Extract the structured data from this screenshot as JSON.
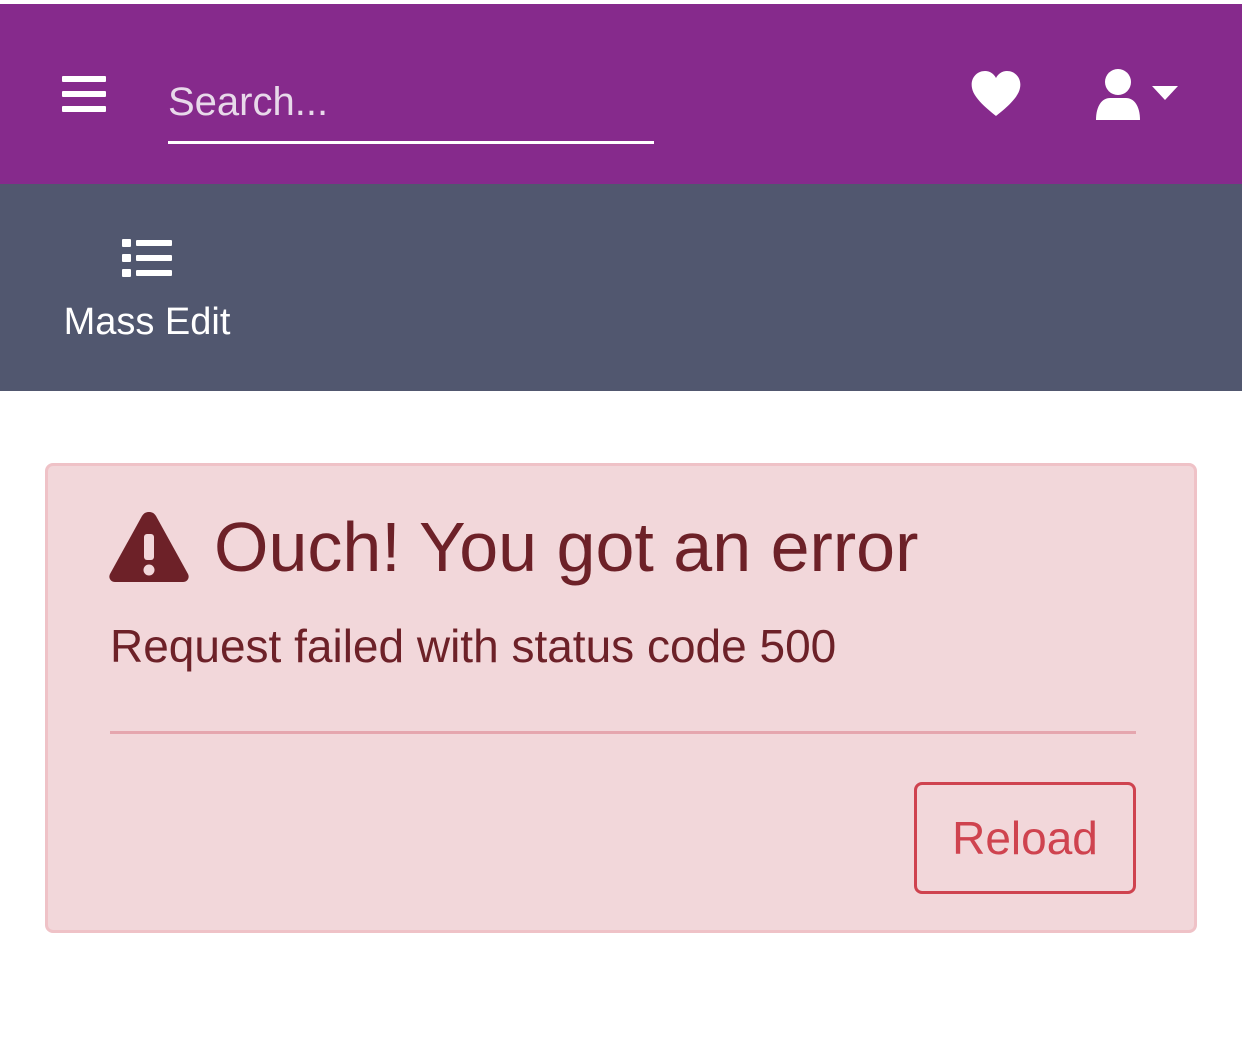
{
  "header": {
    "search": {
      "placeholder": "Search...",
      "value": ""
    },
    "icons": [
      "hamburger-menu-icon",
      "heart-icon",
      "user-icon",
      "caret-down-icon"
    ],
    "background_color": "#862a8c"
  },
  "toolbar": {
    "background_color": "#51576f",
    "mass_edit": {
      "label": "Mass Edit",
      "icon": "list-icon"
    }
  },
  "error_alert": {
    "icon": "warning-triangle-icon",
    "title": "Ouch! You got an error",
    "message": "Request failed with status code 500",
    "reload_label": "Reload",
    "colors": {
      "background": "#f2d7da",
      "border": "#efc2c7",
      "text": "#6d2128",
      "button": "#cf434f"
    }
  }
}
